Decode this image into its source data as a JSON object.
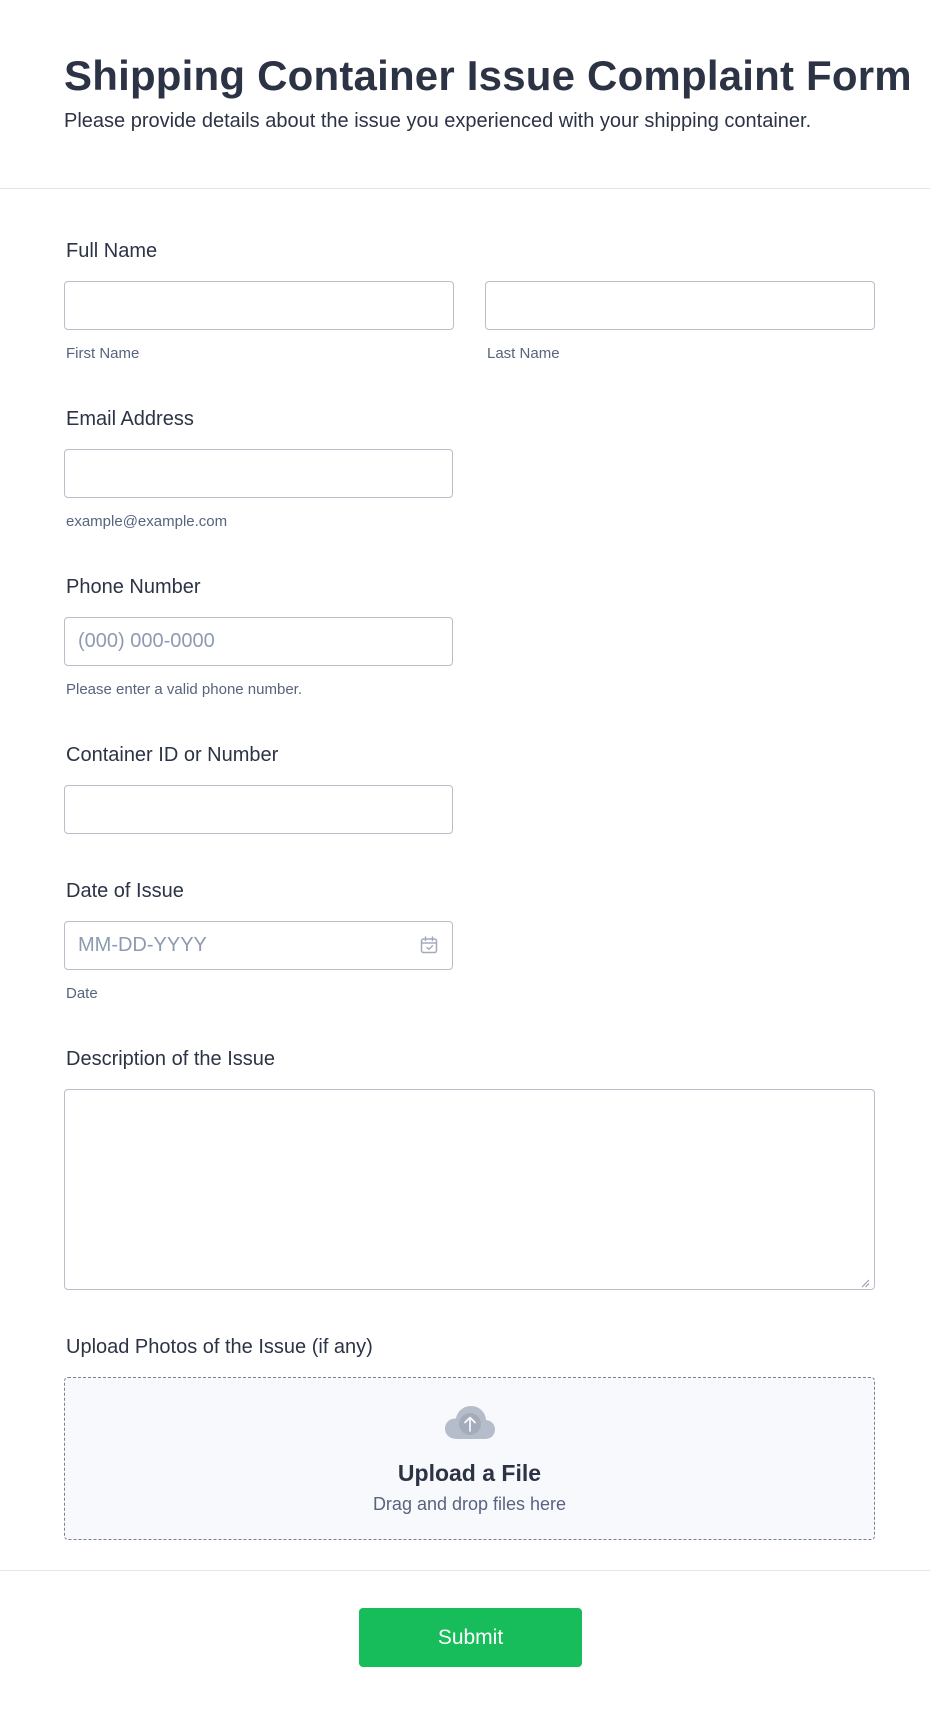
{
  "form": {
    "title": "Shipping Container Issue Complaint Form",
    "subtitle": "Please provide details about the issue you experienced with your shipping container."
  },
  "full_name": {
    "label": "Full Name",
    "first": {
      "value": "",
      "sublabel": "First Name"
    },
    "last": {
      "value": "",
      "sublabel": "Last Name"
    }
  },
  "email": {
    "label": "Email Address",
    "value": "",
    "sublabel": "example@example.com"
  },
  "phone": {
    "label": "Phone Number",
    "placeholder": "(000) 000-0000",
    "sublabel": "Please enter a valid phone number."
  },
  "container": {
    "label": "Container ID or Number",
    "value": ""
  },
  "date": {
    "label": "Date of Issue",
    "placeholder": "MM-DD-YYYY",
    "sublabel": "Date",
    "icon": "calendar-icon"
  },
  "description": {
    "label": "Description of the Issue",
    "value": ""
  },
  "upload": {
    "label": "Upload Photos of the Issue (if any)",
    "title": "Upload a File",
    "subtitle": "Drag and drop files here",
    "icon": "cloud-upload-icon"
  },
  "submit": {
    "label": "Submit"
  },
  "colors": {
    "text": "#2c3345",
    "sublabel": "#57647e",
    "border": "#b8bdc9",
    "submit_bg": "#18bd5b",
    "upload_bg": "#f8f9fc"
  }
}
